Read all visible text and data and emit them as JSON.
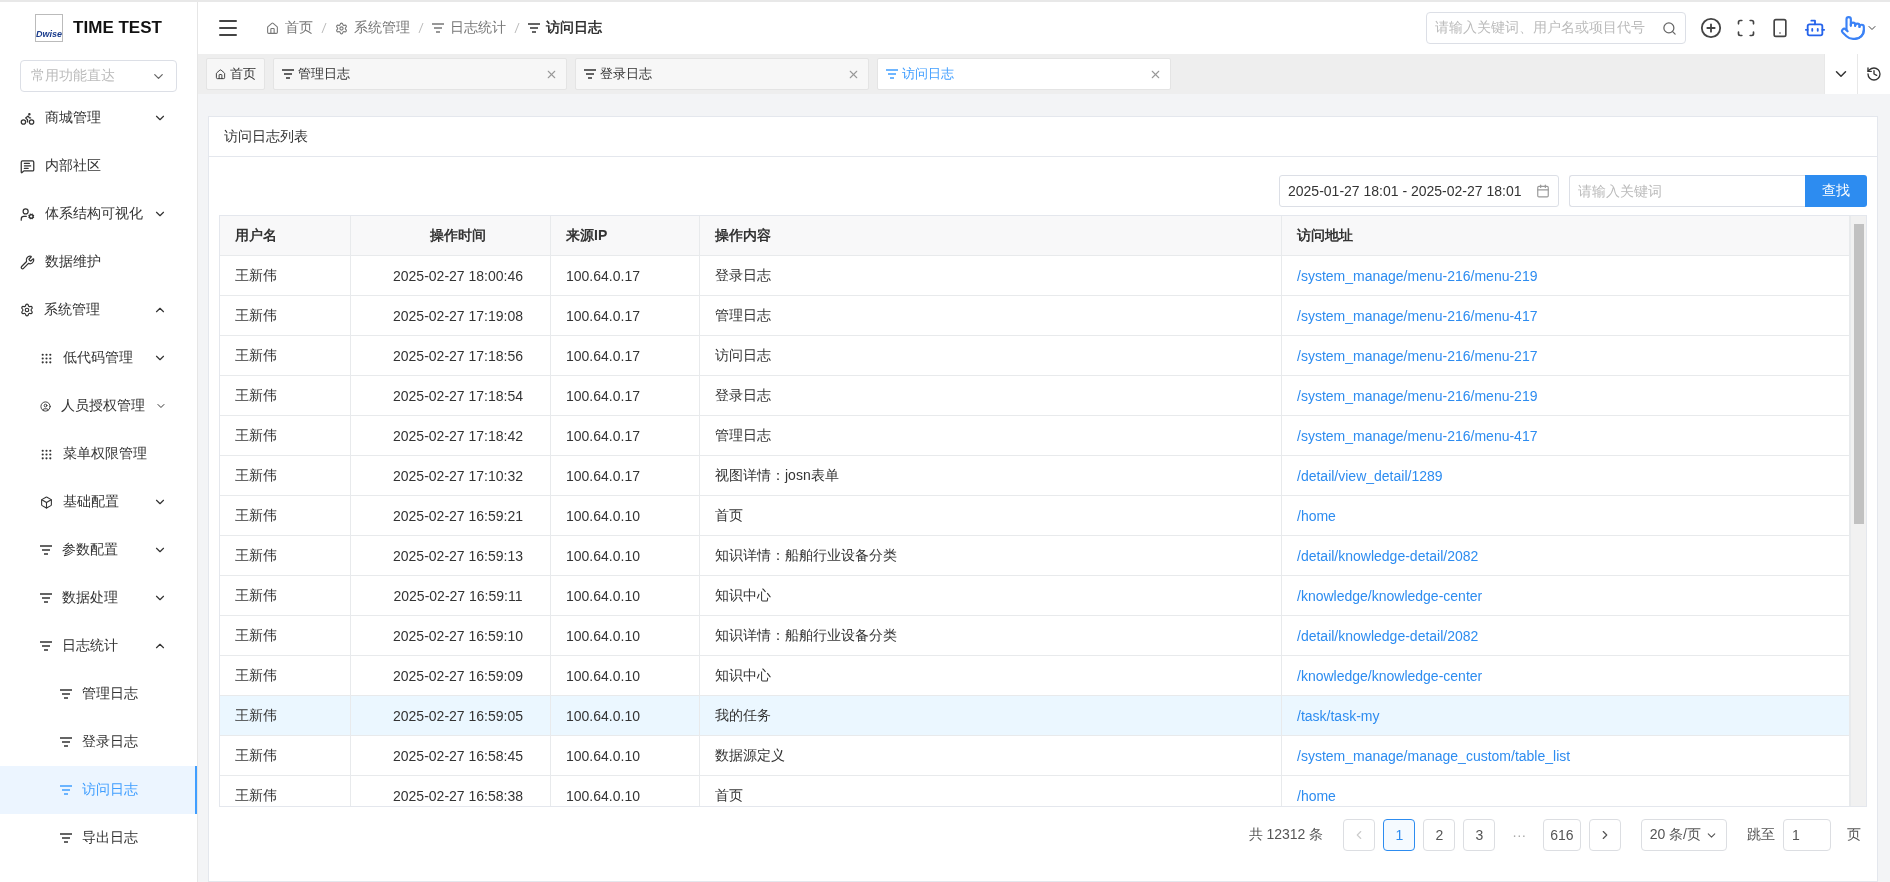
{
  "brand": {
    "logo": "Dwise",
    "title": "TIME TEST"
  },
  "quick_select": {
    "placeholder": "常用功能直达"
  },
  "sidebar": {
    "items": [
      {
        "label": "商城管理",
        "expanded": false,
        "selected": false
      },
      {
        "label": "内部社区",
        "selected": false
      },
      {
        "label": "体系结构可视化",
        "expanded": false,
        "selected": false
      },
      {
        "label": "数据维护",
        "selected": false
      },
      {
        "label": "系统管理",
        "expanded": true,
        "selected": false,
        "children": [
          {
            "label": "低代码管理",
            "expanded": false,
            "selected": false
          },
          {
            "label": "人员授权管理",
            "expanded": false,
            "selected": false
          },
          {
            "label": "菜单权限管理",
            "selected": false
          },
          {
            "label": "基础配置",
            "expanded": false,
            "selected": false
          },
          {
            "label": "参数配置",
            "expanded": false,
            "selected": false
          },
          {
            "label": "数据处理",
            "expanded": false,
            "selected": false
          },
          {
            "label": "日志统计",
            "expanded": true,
            "selected": false,
            "children": [
              {
                "label": "管理日志",
                "selected": false
              },
              {
                "label": "登录日志",
                "selected": false
              },
              {
                "label": "访问日志",
                "selected": true
              },
              {
                "label": "导出日志",
                "selected": false
              }
            ]
          }
        ]
      }
    ]
  },
  "breadcrumb": [
    "首页",
    "系统管理",
    "日志统计",
    "访问日志"
  ],
  "header_search": {
    "placeholder": "请输入关键词、用户名或项目代号"
  },
  "tabs": [
    {
      "label": "首页",
      "selected": false,
      "kind": "home"
    },
    {
      "label": "管理日志",
      "selected": false,
      "kind": "page"
    },
    {
      "label": "登录日志",
      "selected": false,
      "kind": "page"
    },
    {
      "label": "访问日志",
      "selected": true,
      "kind": "page"
    }
  ],
  "card": {
    "title": "访问日志列表"
  },
  "filters": {
    "date_range": "2025-01-27 18:01 - 2025-02-27 18:01",
    "keyword": {
      "placeholder": "请输入关键词"
    },
    "search_button": "查找"
  },
  "table": {
    "columns": [
      "用户名",
      "操作时间",
      "来源IP",
      "操作内容",
      "访问地址"
    ],
    "rows": [
      {
        "cells": [
          "王新伟",
          "2025-02-27 18:00:46",
          "100.64.0.17",
          "登录日志",
          "/system_manage/menu-216/menu-219"
        ],
        "selected": false
      },
      {
        "cells": [
          "王新伟",
          "2025-02-27 17:19:08",
          "100.64.0.17",
          "管理日志",
          "/system_manage/menu-216/menu-417"
        ],
        "selected": false
      },
      {
        "cells": [
          "王新伟",
          "2025-02-27 17:18:56",
          "100.64.0.17",
          "访问日志",
          "/system_manage/menu-216/menu-217"
        ],
        "selected": false
      },
      {
        "cells": [
          "王新伟",
          "2025-02-27 17:18:54",
          "100.64.0.17",
          "登录日志",
          "/system_manage/menu-216/menu-219"
        ],
        "selected": false
      },
      {
        "cells": [
          "王新伟",
          "2025-02-27 17:18:42",
          "100.64.0.17",
          "管理日志",
          "/system_manage/menu-216/menu-417"
        ],
        "selected": false
      },
      {
        "cells": [
          "王新伟",
          "2025-02-27 17:10:32",
          "100.64.0.17",
          "视图详情：josn表单",
          "/detail/view_detail/1289"
        ],
        "selected": false
      },
      {
        "cells": [
          "王新伟",
          "2025-02-27 16:59:21",
          "100.64.0.10",
          "首页",
          "/home"
        ],
        "selected": false
      },
      {
        "cells": [
          "王新伟",
          "2025-02-27 16:59:13",
          "100.64.0.10",
          "知识详情：船舶行业设备分类",
          "/detail/knowledge-detail/2082"
        ],
        "selected": false
      },
      {
        "cells": [
          "王新伟",
          "2025-02-27 16:59:11",
          "100.64.0.10",
          "知识中心",
          "/knowledge/knowledge-center"
        ],
        "selected": false
      },
      {
        "cells": [
          "王新伟",
          "2025-02-27 16:59:10",
          "100.64.0.10",
          "知识详情：船舶行业设备分类",
          "/detail/knowledge-detail/2082"
        ],
        "selected": false
      },
      {
        "cells": [
          "王新伟",
          "2025-02-27 16:59:09",
          "100.64.0.10",
          "知识中心",
          "/knowledge/knowledge-center"
        ],
        "selected": false
      },
      {
        "cells": [
          "王新伟",
          "2025-02-27 16:59:05",
          "100.64.0.10",
          "我的任务",
          "/task/task-my"
        ],
        "selected": true
      },
      {
        "cells": [
          "王新伟",
          "2025-02-27 16:58:45",
          "100.64.0.10",
          "数据源定义",
          "/system_manage/manage_custom/table_list"
        ],
        "selected": false
      },
      {
        "cells": [
          "王新伟",
          "2025-02-27 16:58:38",
          "100.64.0.10",
          "首页",
          "/home"
        ],
        "selected": false
      }
    ]
  },
  "pagination": {
    "total": "共 12312 条",
    "pages": [
      {
        "label": "1",
        "selected": true
      },
      {
        "label": "2",
        "selected": false
      },
      {
        "label": "3",
        "selected": false
      },
      {
        "label": "···",
        "kind": "ellipsis"
      },
      {
        "label": "616",
        "selected": false
      }
    ],
    "page_size": "20 条/页",
    "jump_label": "跳至",
    "jump_value": "1",
    "page_unit": "页"
  }
}
